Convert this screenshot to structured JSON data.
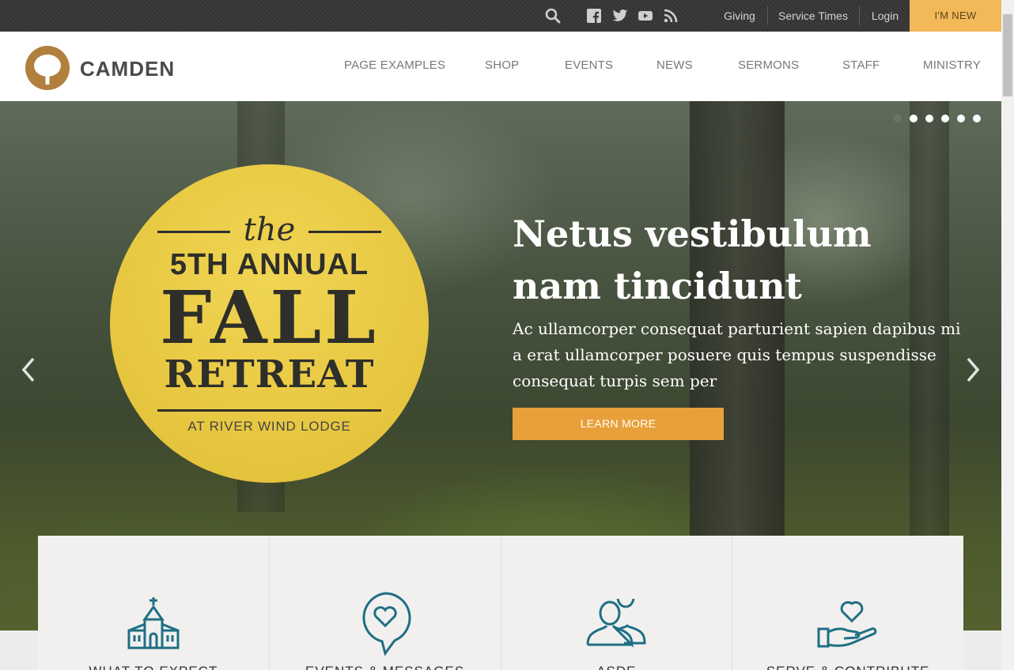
{
  "topbar": {
    "icons": [
      "search-icon",
      "facebook-icon",
      "twitter-icon",
      "youtube-icon",
      "rss-icon"
    ],
    "links": [
      "Giving",
      "Service Times",
      "Login"
    ],
    "cta": "I'M NEW",
    "cta_color": "#f3b857"
  },
  "header": {
    "brand": "CAMDEN",
    "logo_color": "#b17f3e",
    "nav": [
      "PAGE EXAMPLES",
      "SHOP",
      "EVENTS",
      "NEWS",
      "SERMONS",
      "STAFF",
      "MINISTRY"
    ]
  },
  "hero": {
    "badge": {
      "the": "the",
      "annual": "5TH ANNUAL",
      "fall": "FALL",
      "retreat": "RETREAT",
      "lodge": "AT RIVER WIND LODGE"
    },
    "title": "Netus vestibulum nam tincidunt",
    "body": "Ac ullamcorper consequat parturient sapien dapibus mi a erat ullamcorper posuere quis tempus suspendisse consequat turpis sem per",
    "button": "LEARN MORE",
    "button_color": "#e8a03a",
    "slide_count": 6,
    "active_slide": 1
  },
  "features": [
    {
      "label": "WHAT TO EXPECT",
      "icon": "church-icon"
    },
    {
      "label": "EVENTS & MESSAGES",
      "icon": "heart-chat-icon"
    },
    {
      "label": "ASDE",
      "icon": "people-icon"
    },
    {
      "label": "SERVE & CONTRIBUTE",
      "icon": "heart-hand-icon"
    }
  ],
  "accent_icon_color": "#1f6f84"
}
